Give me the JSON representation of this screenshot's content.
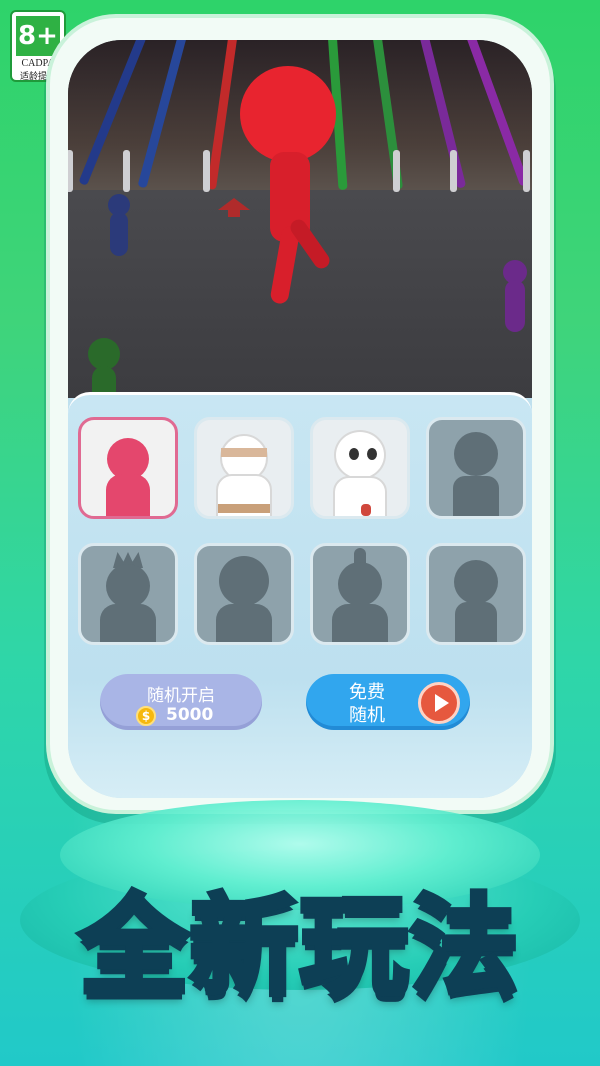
{
  "age_rating": {
    "number": "8+",
    "org": "CADPA",
    "tip": "适龄提示"
  },
  "colors": {
    "bg_green": "#2ed36a",
    "bg_teal": "#21c9c9",
    "selected_border": "#e06a92",
    "random_button": "#a9b5e6",
    "free_button": "#31a6ee",
    "play_icon": "#e6583e",
    "headline": "#6ef0ff"
  },
  "game_scene": {
    "player_color": "#e8242f",
    "npc_colors": [
      "#2b3a7a",
      "#6b2a8a",
      "#2a6a2a"
    ]
  },
  "skins": [
    {
      "state": "selected",
      "icon": "pink-stickman-icon"
    },
    {
      "state": "unlocked",
      "icon": "mummy-stickman-icon"
    },
    {
      "state": "unlocked",
      "icon": "skull-stickman-icon"
    },
    {
      "state": "locked",
      "icon": "skeleton-silhouette-icon"
    },
    {
      "state": "locked",
      "icon": "crown-silhouette-icon"
    },
    {
      "state": "locked",
      "icon": "spiky-silhouette-icon"
    },
    {
      "state": "locked",
      "icon": "crest-silhouette-icon"
    },
    {
      "state": "locked",
      "icon": "plain-silhouette-icon"
    }
  ],
  "buttons": {
    "random_unlock": {
      "label": "随机开启",
      "price": "5000",
      "icon": "coin-icon"
    },
    "free_random": {
      "line1": "免费",
      "line2": "随机",
      "icon": "play-icon"
    }
  },
  "headline": "全新玩法"
}
